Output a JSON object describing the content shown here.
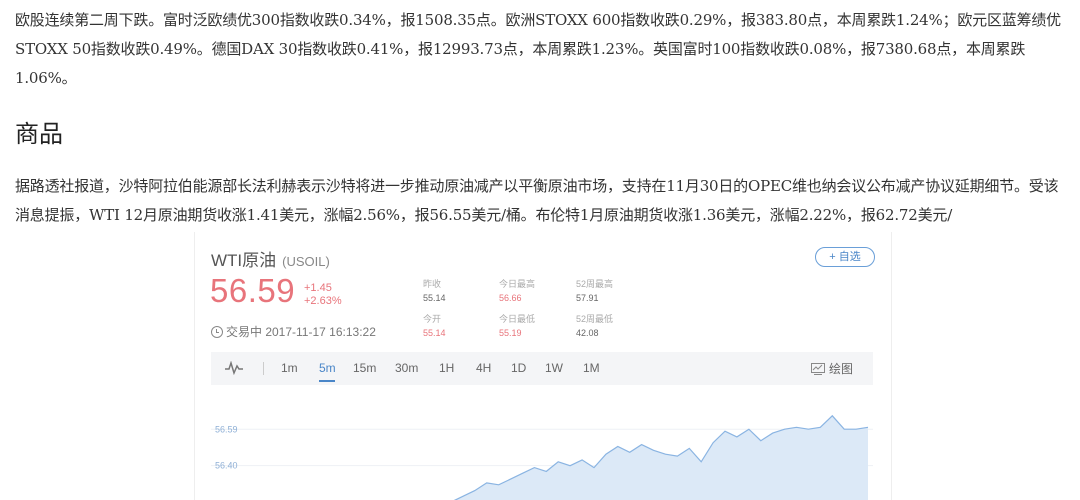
{
  "article": {
    "p1": "欧股连续第二周下跌。富时泛欧绩优300指数收跌0.34%，报1508.35点。欧洲STOXX 600指数收跌0.29%，报383.80点，本周累跌1.24%；欧元区蓝筹绩优STOXX 50指数收跌0.49%。德国DAX 30指数收跌0.41%，报12993.73点，本周累跌1.23%。英国富时100指数收跌0.08%，报7380.68点，本周累跌1.06%。",
    "section_title": "商品",
    "p2": "据路透社报道，沙特阿拉伯能源部长法利赫表示沙特将进一步推动原油减产以平衡原油市场，支持在11月30日的OPEC维也纳会议公布减产协议延期细节。受该消息提振，WTI 12月原油期货收涨1.41美元，涨幅2.56%，报56.55美元/桶。布伦特1月原油期货收涨1.36美元，涨幅2.22%，报62.72美元/"
  },
  "quote": {
    "name": "WTI原油",
    "symbol": "(USOIL)",
    "follow_label": "+ 自选",
    "price": "56.59",
    "change_abs": "+1.45",
    "change_pct": "+2.63%",
    "status": "交易中 2017-11-17 16:13:22",
    "stats": {
      "prev_close": {
        "label": "昨收",
        "value": "55.14"
      },
      "day_high": {
        "label": "今日最高",
        "value": "56.66"
      },
      "week52_high": {
        "label": "52周最高",
        "value": "57.91"
      },
      "open": {
        "label": "今开",
        "value": "55.14"
      },
      "day_low": {
        "label": "今日最低",
        "value": "55.19"
      },
      "week52_low": {
        "label": "52周最低",
        "value": "42.08"
      }
    },
    "tabs": [
      "1m",
      "5m",
      "15m",
      "30m",
      "1H",
      "4H",
      "1D",
      "1W",
      "1M"
    ],
    "active_tab": "5m",
    "draw_label": "绘图",
    "colors": {
      "up": "#e8747b",
      "accent": "#4a86c8",
      "area": "#dce9f7"
    }
  },
  "chart_data": {
    "type": "area",
    "y_tick_labels": [
      "56.59",
      "56.40"
    ],
    "ylim": [
      56.2,
      56.8
    ],
    "values": [
      56.21,
      56.24,
      56.27,
      56.31,
      56.3,
      56.33,
      56.36,
      56.39,
      56.37,
      56.42,
      56.4,
      56.43,
      56.39,
      56.46,
      56.5,
      56.47,
      56.51,
      56.48,
      56.46,
      56.45,
      56.49,
      56.42,
      56.52,
      56.58,
      56.55,
      56.59,
      56.53,
      56.57,
      56.59,
      56.6,
      56.59,
      56.6,
      56.66,
      56.59,
      56.59,
      56.6
    ]
  }
}
